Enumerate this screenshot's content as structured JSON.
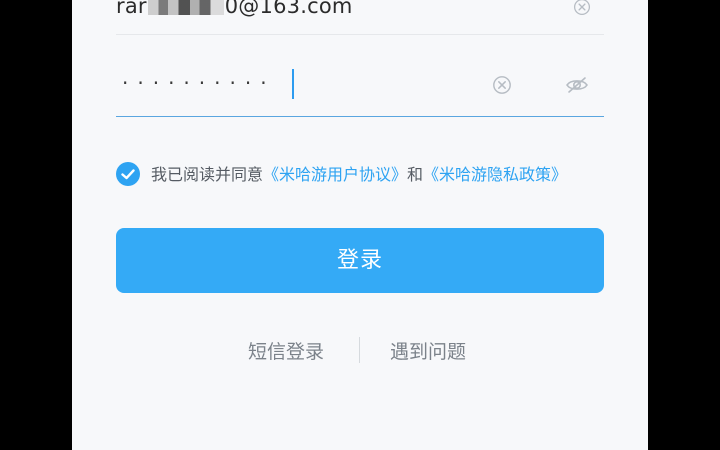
{
  "login_form": {
    "email_prefix": "rar",
    "email_suffix": "0@163.com",
    "password_mask": "··········",
    "agreement": {
      "lead": "我已阅读并同意",
      "user_agreement": "《米哈游用户协议》",
      "conjunction": "和",
      "privacy_policy": "《米哈游隐私政策》"
    },
    "login_button": "登录",
    "sms_login": "短信登录",
    "help": "遇到问题"
  },
  "colors": {
    "accent": "#34aaf6",
    "link": "#2ea3f2",
    "panel_bg": "#f7f8fa",
    "outer_bg": "#000000"
  },
  "icons": {
    "clear": "clear-circle-icon",
    "visibility": "eye-off-icon",
    "check": "check-circle-icon"
  }
}
